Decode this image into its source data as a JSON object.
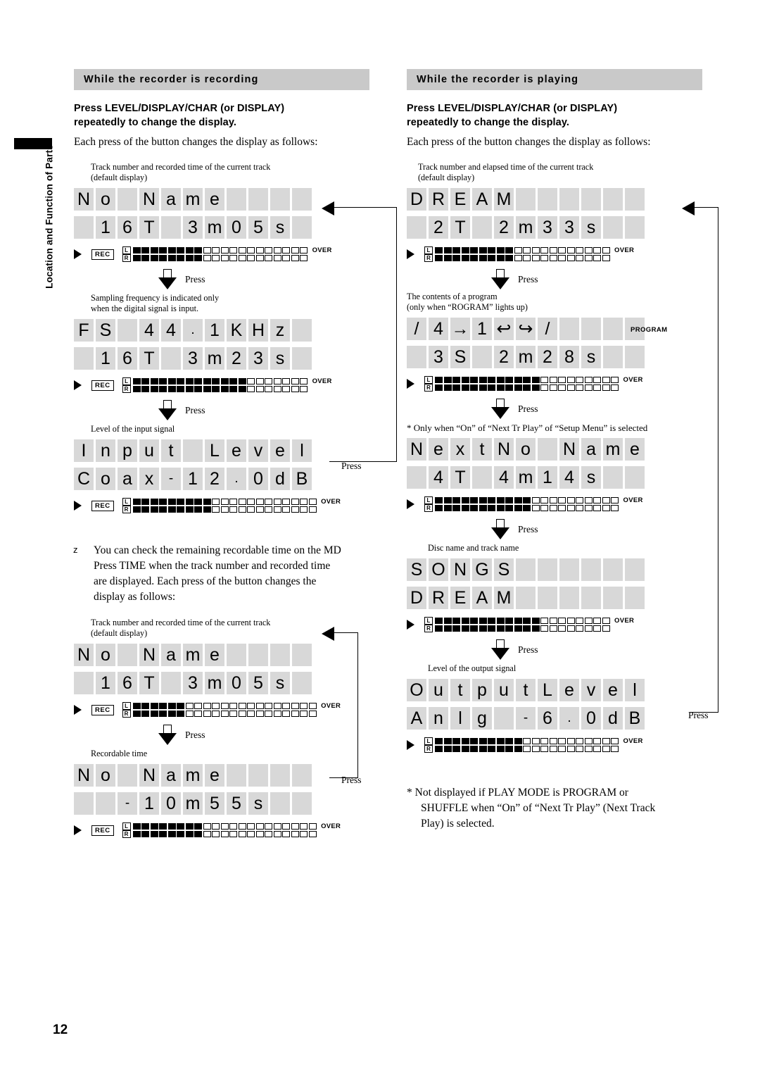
{
  "sidebar": {
    "label": "Location and Function of Parts"
  },
  "page": {
    "number": "12"
  },
  "left": {
    "heading": "While the recorder is recording",
    "subhead_line1": "Press LEVEL/DISPLAY/CHAR (or DISPLAY)",
    "subhead_line2": "repeatedly to change the display.",
    "intro": "Each press of the button changes the display as follows:",
    "cap1_line1": "Track number and recorded time of the current track",
    "cap1_line2": "(default display)",
    "cap2_line1": "Sampling frequency is indicated only",
    "cap2_line2": "when the digital signal is input.",
    "cap3": "Level of the input signal",
    "press": "Press",
    "tip_mark": "z",
    "tip_line1": "You can check the remaining recordable time on the MD",
    "tip_line2": "Press TIME when the track number and recorded time",
    "tip_line3": "are displayed.  Each press of the button changes the",
    "tip_line4": "display as follows:",
    "cap4_line1": "Track number and recorded time of the current track",
    "cap4_line2": "(default display)",
    "cap5": "Recordable time",
    "displays": [
      {
        "name": "no-name-16t-3m05s",
        "row1": [
          "N",
          "o",
          " ",
          "N",
          "a",
          "m",
          "e",
          " ",
          " ",
          " ",
          " "
        ],
        "row2": [
          " ",
          "1",
          "6",
          "T",
          " ",
          "3",
          "m",
          "0",
          "5",
          "s",
          " "
        ],
        "meter": {
          "rec": "REC",
          "l_on": 8,
          "l_total": 20,
          "r_on": 8,
          "r_total": 20,
          "over": "OVER"
        }
      },
      {
        "name": "fs-441khz",
        "row1": [
          "F",
          "S",
          " ",
          "4",
          "4",
          ".",
          "1",
          "K",
          "H",
          "z",
          " "
        ],
        "row2": [
          " ",
          "1",
          "6",
          "T",
          " ",
          "3",
          "m",
          "2",
          "3",
          "s",
          " "
        ],
        "meter": {
          "rec": "REC",
          "l_on": 13,
          "l_total": 20,
          "r_on": 13,
          "r_total": 20,
          "over": "OVER"
        }
      },
      {
        "name": "input-level-coax",
        "row1": [
          "I",
          "n",
          "p",
          "u",
          "t",
          " ",
          "L",
          "e",
          "v",
          "e",
          "l"
        ],
        "row2": [
          "C",
          "o",
          "a",
          "x",
          "-",
          "1",
          "2",
          ".",
          "0",
          "d",
          "B"
        ],
        "meter": {
          "rec": "REC",
          "l_on": 9,
          "l_total": 21,
          "r_on": 9,
          "r_total": 21,
          "over": "OVER"
        }
      },
      {
        "name": "no-name-16t-3m05s-2",
        "row1": [
          "N",
          "o",
          " ",
          "N",
          "a",
          "m",
          "e",
          " ",
          " ",
          " ",
          " "
        ],
        "row2": [
          " ",
          "1",
          "6",
          "T",
          " ",
          "3",
          "m",
          "0",
          "5",
          "s",
          " "
        ],
        "meter": {
          "rec": "REC",
          "l_on": 6,
          "l_total": 21,
          "r_on": 6,
          "r_total": 21,
          "over": "OVER"
        }
      },
      {
        "name": "no-name-minus-10m55s",
        "row1": [
          "N",
          "o",
          " ",
          "N",
          "a",
          "m",
          "e",
          " ",
          " ",
          " ",
          " "
        ],
        "row2": [
          " ",
          " ",
          "-",
          "1",
          "0",
          "m",
          "5",
          "5",
          "s",
          " ",
          " "
        ],
        "meter": {
          "rec": "REC",
          "l_on": 8,
          "l_total": 21,
          "r_on": 8,
          "r_total": 21,
          "over": "OVER"
        }
      }
    ]
  },
  "right": {
    "heading": "While the recorder is playing",
    "subhead_line1": "Press LEVEL/DISPLAY/CHAR (or DISPLAY)",
    "subhead_line2": "repeatedly to change the display.",
    "intro": "Each press of the button changes the display as follows:",
    "cap1_line1": "Track number and elapsed time of the current track",
    "cap1_line2": "(default display)",
    "cap2_line1": "The contents of a program",
    "cap2_line2": "(only when “ROGRAM” lights up)",
    "program_indicator": "PROGRAM",
    "star1": "*  Only when “On” of “Next Tr Play” of “Setup Menu” is selected",
    "cap3": "Disc name and track name",
    "cap4": "Level of the output signal",
    "press": "Press",
    "footnote_line1": "*  Not displayed if PLAY MODE is PROGRAM or",
    "footnote_line2": "SHUFFLE when “On” of “Next Tr Play” (Next Track",
    "footnote_line3": "Play) is selected.",
    "displays": [
      {
        "name": "dream-2t-2m33s",
        "row1": [
          "D",
          "R",
          "E",
          "A",
          "M",
          " ",
          " ",
          " ",
          " ",
          " ",
          " "
        ],
        "row2": [
          " ",
          "2",
          "T",
          " ",
          "2",
          "m",
          "3",
          "3",
          "s",
          " ",
          " "
        ],
        "meter": {
          "l_on": 9,
          "l_total": 20,
          "r_on": 9,
          "r_total": 20,
          "over": "OVER"
        }
      },
      {
        "name": "program-3s-2m28s",
        "row1": [
          "/",
          "4",
          "→",
          "1",
          "↩",
          "↪",
          "/",
          " ",
          " ",
          " ",
          " "
        ],
        "row2": [
          " ",
          "3",
          "S",
          " ",
          "2",
          "m",
          "2",
          "8",
          "s",
          " ",
          " "
        ],
        "meter": {
          "l_on": 12,
          "l_total": 21,
          "r_on": 12,
          "r_total": 21,
          "over": "OVER"
        }
      },
      {
        "name": "nextno-name-4t-4m14s",
        "row1": [
          "N",
          "e",
          "x",
          "t",
          "N",
          "o",
          " ",
          "N",
          "a",
          "m",
          "e"
        ],
        "row2": [
          " ",
          "4",
          "T",
          " ",
          "4",
          "m",
          "1",
          "4",
          "s",
          " ",
          " "
        ],
        "meter": {
          "l_on": 11,
          "l_total": 21,
          "r_on": 11,
          "r_total": 21,
          "over": "OVER"
        }
      },
      {
        "name": "songs-dream",
        "row1": [
          "S",
          "O",
          "N",
          "G",
          "S",
          " ",
          " ",
          " ",
          " ",
          " ",
          " "
        ],
        "row2": [
          "D",
          "R",
          "E",
          "A",
          "M",
          " ",
          " ",
          " ",
          " ",
          " ",
          " "
        ],
        "meter": {
          "l_on": 12,
          "l_total": 20,
          "r_on": 12,
          "r_total": 20,
          "over": "OVER"
        }
      },
      {
        "name": "output-level-anlg",
        "row1": [
          "O",
          "u",
          "t",
          "p",
          "u",
          "t",
          "L",
          "e",
          "v",
          "e",
          "l"
        ],
        "row2": [
          "A",
          "n",
          "l",
          "g",
          " ",
          "-",
          "6",
          ".",
          "0",
          "d",
          "B"
        ],
        "meter": {
          "l_on": 10,
          "l_total": 21,
          "r_on": 10,
          "r_total": 21,
          "over": "OVER"
        }
      }
    ]
  }
}
